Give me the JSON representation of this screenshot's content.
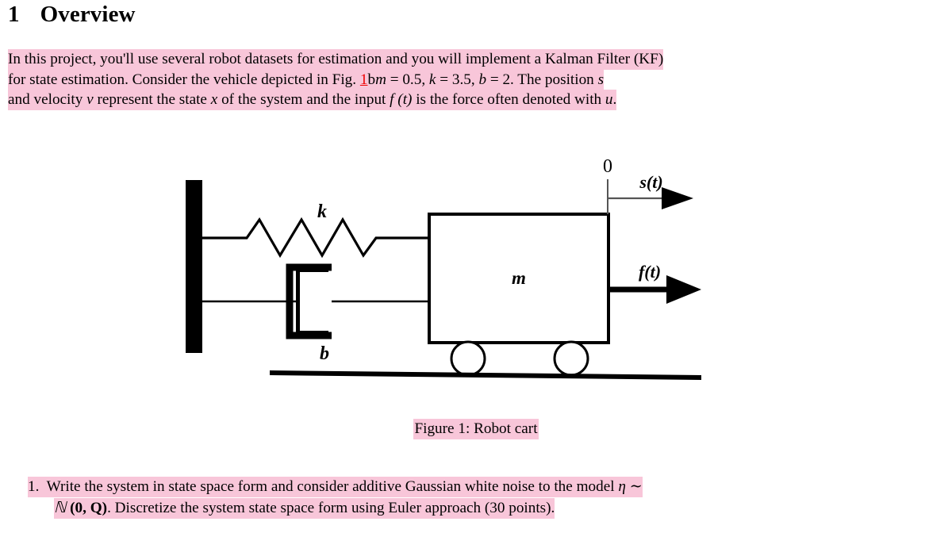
{
  "heading": {
    "number": "1",
    "title": "Overview"
  },
  "intro": {
    "line1": "In this project, you'll use several robot datasets for estimation and you will implement a Kalman Filter (KF)",
    "line2_a": "for state estimation.  Consider the vehicle depicted in Fig. ",
    "line2_ref": "1",
    "line2_b": "b",
    "line2_m": "m",
    "line2_m_val": " = 0.5,  ",
    "line2_k": "k",
    "line2_k_val": " = 3.5,  ",
    "line2_b_val": " = 2.  The position ",
    "line2_s": "s",
    "line3_a": "and velocity ",
    "line3_v": "v",
    "line3_b": " represent the state ",
    "line3_x": "x",
    "line3_c": " of the system and the input ",
    "line3_f": "f (t)",
    "line3_d": " is the force often denoted with ",
    "line3_u": "u",
    "line3_e": "."
  },
  "figure": {
    "caption": "Figure 1: Robot cart",
    "labels": {
      "spring": "k",
      "damper": "b",
      "mass": "m",
      "origin": "0",
      "displacement": "s(t)",
      "force": "f(t)"
    }
  },
  "question": {
    "marker": "1.",
    "line1": "Write the system in state space form and consider additive Gaussian white noise to the model ",
    "line1_eta": "η",
    "line1_tilde": " ∼",
    "line2_N": "ℕ",
    "line2_args": " (0, Q)",
    "line2_rest": ".  Discretize the system state space form using Euler approach (30 points)."
  },
  "colors": {
    "highlight": "#f8c6d9",
    "reference_link": "#ee0000",
    "ink": "#000000",
    "page_background": "#ffffff"
  }
}
